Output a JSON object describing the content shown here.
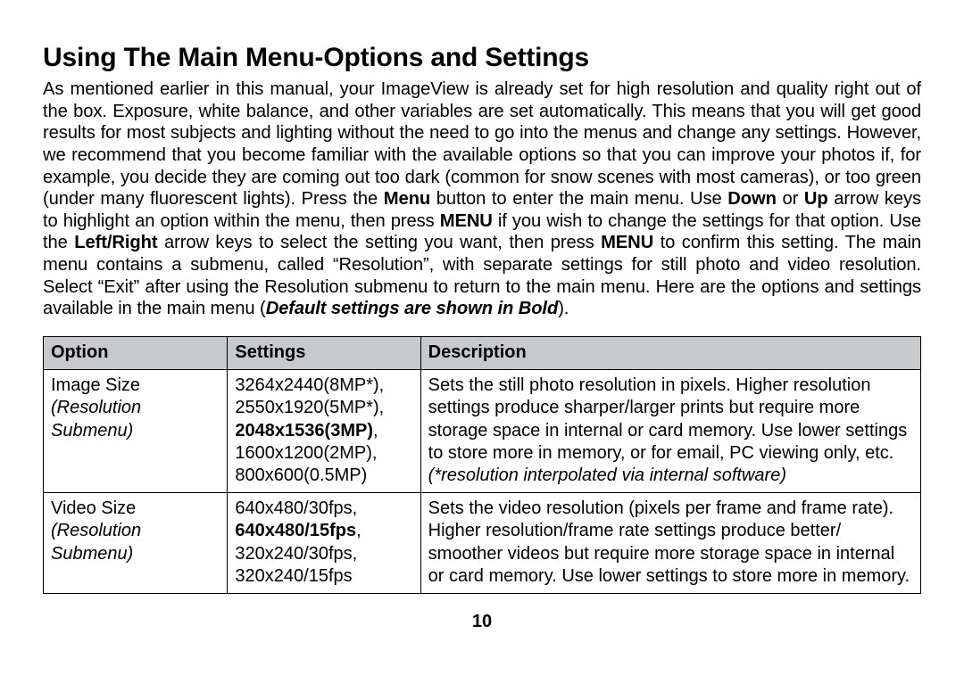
{
  "heading": "Using The Main Menu-Options and Settings",
  "intro": {
    "t1": "As mentioned earlier in this manual, your ImageView is already set for high resolution and quality right out of the box. Exposure, white balance, and other variables are set automatically.  This means that you will get good results for most subjects and lighting without the need to go into the menus and change any settings. However, we recommend that you become familiar with the available options so that you can improve your photos if, for example, you decide they are coming out too dark (common for snow scenes with most cameras), or too green (under many fluorescent lights). Press the ",
    "b1": "Menu",
    "t2": " button to enter the main menu. Use ",
    "b2": "Down",
    "t3": " or ",
    "b3": "Up",
    "t4": " arrow keys to highlight an option within the menu, then press ",
    "b4": "MENU",
    "t5": " if you wish to change the settings for that option. Use the ",
    "b5": "Left/Right",
    "t6": " arrow keys to select the setting you want, then press ",
    "b6": "MENU",
    "t7": " to confirm this setting. The main menu contains a submenu, called “Resolution”, with separate settings for still photo and video resolution. Select “Exit” after using the Resolution submenu to return to the main menu. Here are the options and settings available in the main menu (",
    "bi1": "Default settings are shown in Bold",
    "t8": ")."
  },
  "table": {
    "headers": {
      "option": "Option",
      "settings": "Settings",
      "description": "Description"
    },
    "rows": [
      {
        "option_title": "Image Size",
        "option_sub": "(Resolution Submenu)",
        "settings": [
          {
            "text": "3264x2440(8MP*),",
            "default": false
          },
          {
            "text": "2550x1920(5MP*),",
            "default": false
          },
          {
            "text": "2048x1536(3MP)",
            "default": true,
            "trail": ","
          },
          {
            "text": "1600x1200(2MP),",
            "default": false
          },
          {
            "text": "800x600(0.5MP)",
            "default": false
          }
        ],
        "desc_plain": "Sets the still photo resolution in pixels. Higher resolution settings produce sharper/larger prints but require more storage space in internal or card memory. Use lower settings to store more in memory, or for email, PC viewing only, etc. ",
        "desc_italic": "(*resolution interpolated via internal software)"
      },
      {
        "option_title": "Video Size",
        "option_sub": "(Resolution Submenu)",
        "settings": [
          {
            "text": "640x480/30fps,",
            "default": false
          },
          {
            "text": "640x480/15fps",
            "default": true,
            "trail": ","
          },
          {
            "text": "320x240/30fps,",
            "default": false
          },
          {
            "text": "320x240/15fps",
            "default": false
          }
        ],
        "desc_plain": "Sets the video resolution (pixels per frame and frame rate). Higher resolution/frame rate settings produce better/ smoother videos but require more storage space in internal or card memory. Use lower settings to store more in memory.",
        "desc_italic": ""
      }
    ]
  },
  "page_number": "10"
}
